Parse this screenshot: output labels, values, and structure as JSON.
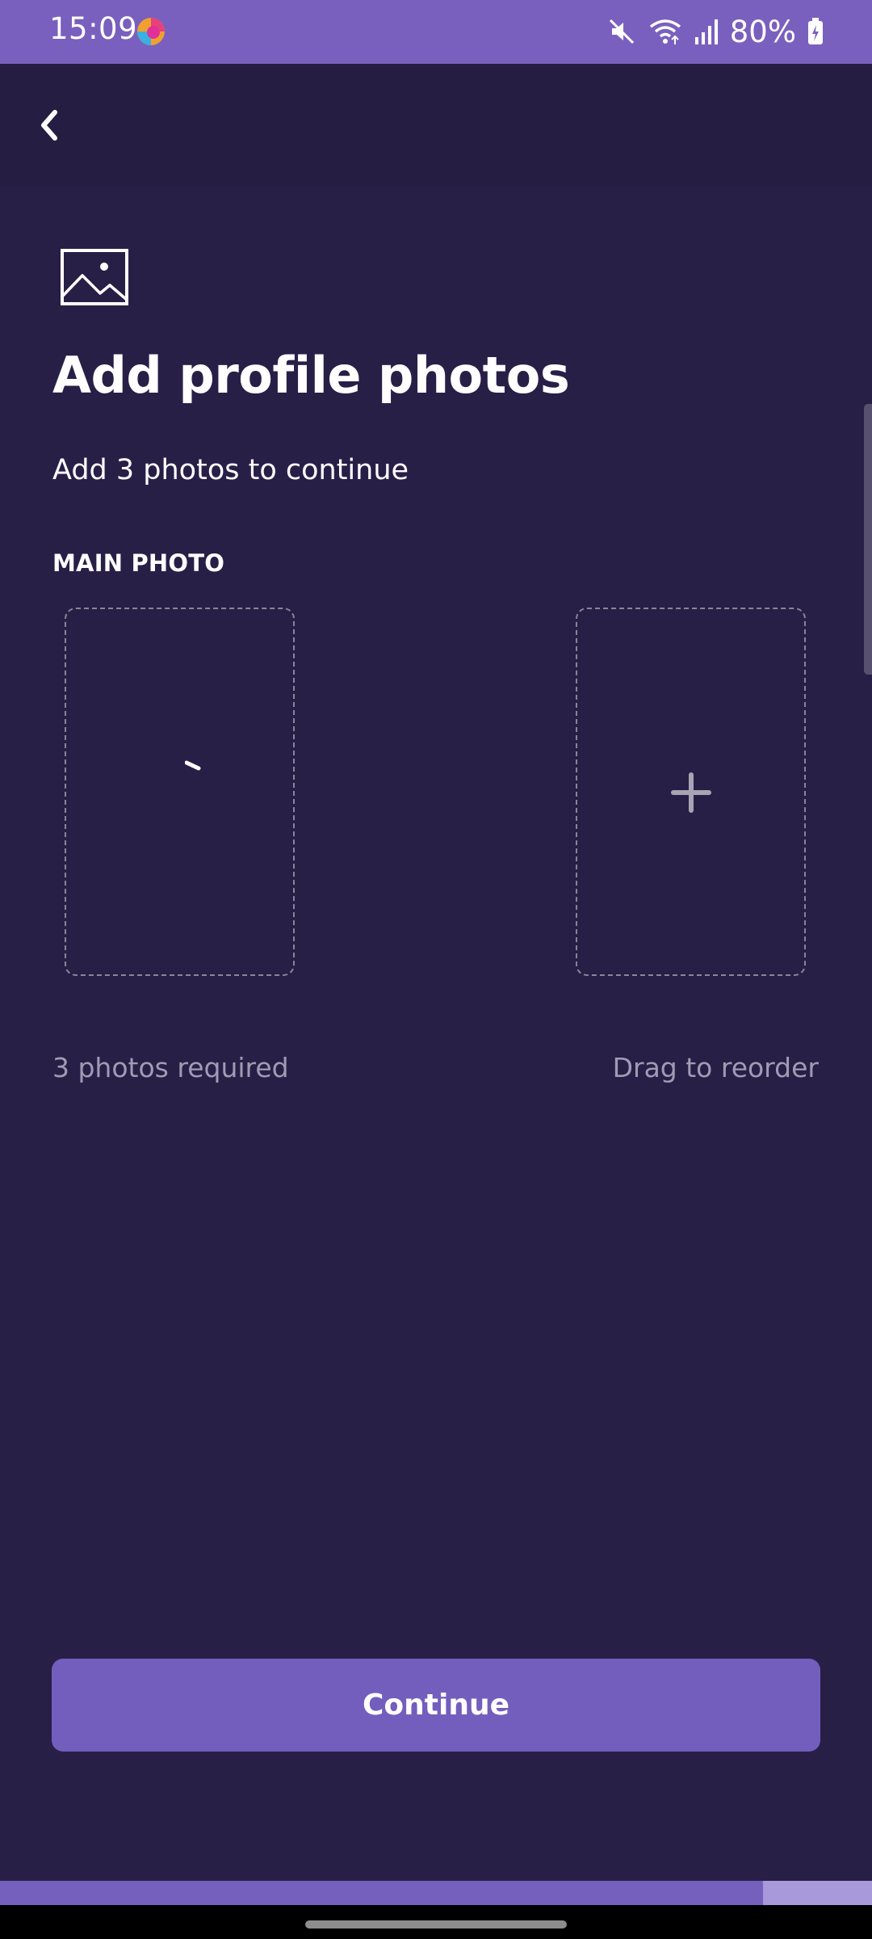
{
  "status_bar": {
    "time": "15:09",
    "battery": "80%",
    "icons": [
      "app-logo-icon",
      "mute-icon",
      "wifi-icon",
      "signal-icon",
      "battery-icon"
    ]
  },
  "header": {
    "back_icon": "chevron-left-icon"
  },
  "main": {
    "icon": "image-icon",
    "title": "Add profile photos",
    "subtitle": "Add 3 photos to continue",
    "section_label": "MAIN PHOTO",
    "slots": [
      {
        "state": "loading"
      },
      {
        "state": "empty",
        "icon": "plus-icon"
      }
    ],
    "hint_left": "3 photos required",
    "hint_right": "Drag to reorder"
  },
  "footer": {
    "continue_label": "Continue"
  },
  "progress": {
    "fraction": 0.875
  },
  "colors": {
    "background": "#281f47",
    "accent": "#7a60be",
    "button": "#735ebd",
    "hint_text": "#a19bb3"
  }
}
